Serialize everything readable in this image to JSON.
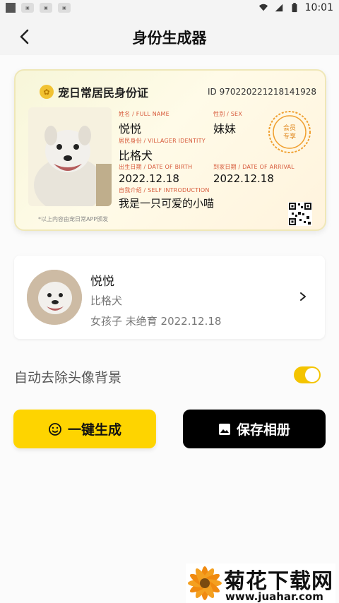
{
  "status_bar": {
    "time": "10:01",
    "mini_icons": [
      "ad1",
      "ad2",
      "ad3"
    ]
  },
  "header": {
    "title": "身份生成器"
  },
  "id_card": {
    "title": "宠日常居民身份证",
    "id_label": "ID",
    "id_number": "970220221218141928",
    "name_label": "姓名 / FULL NAME",
    "name": "悦悦",
    "sex_label": "性别 / SEX",
    "sex": "妹妹",
    "identity_label": "居民身份 / VILLAGER IDENTITY",
    "identity": "比格犬",
    "birth_label": "出生日期 / DATE OF BIRTH",
    "birth": "2022.12.18",
    "arrival_label": "到家日期 / DATE OF ARRIVAL",
    "arrival": "2022.12.18",
    "intro_label": "自我介绍 / SELF INTRODUCTION",
    "intro": "我是一只可爱的小喵",
    "seal_text": "会员专享",
    "footnote": "*以上内容由宠日常APP颁发"
  },
  "profile": {
    "name": "悦悦",
    "breed": "比格犬",
    "meta": "女孩子 未绝育 2022.12.18"
  },
  "settings": {
    "auto_remove_bg_label": "自动去除头像背景",
    "auto_remove_bg_on": true
  },
  "actions": {
    "generate_label": "一键生成",
    "save_label": "保存相册"
  },
  "watermark": {
    "brand": "菊花下载网",
    "url": "www.juahar.com"
  },
  "colors": {
    "accent": "#fed400",
    "label_red": "#d75a3b"
  }
}
